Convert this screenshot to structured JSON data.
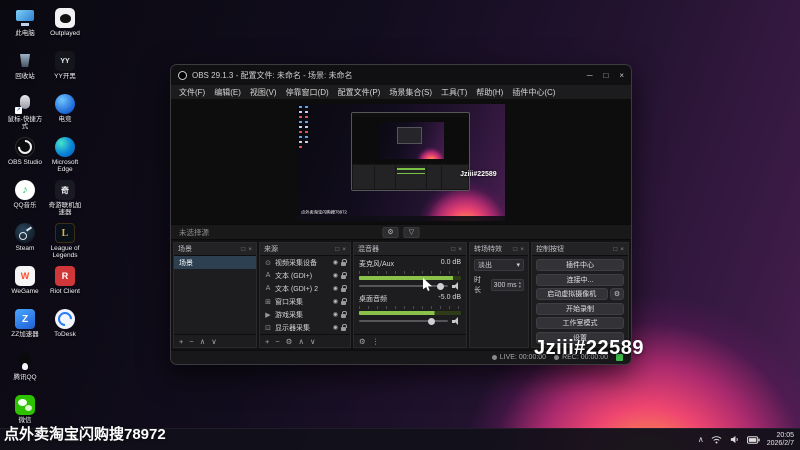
{
  "desktop": {
    "overlay_text": "点外卖淘宝闪购搜78972",
    "watermark": "Jziii#22589",
    "icons_col1": [
      {
        "label": "此电脑"
      },
      {
        "label": "回收站"
      },
      {
        "label": "鼠标-快捷方式"
      },
      {
        "label": "OBS Studio"
      },
      {
        "label": "QQ音乐"
      },
      {
        "label": "Steam"
      },
      {
        "label": "WeGame"
      },
      {
        "label": "ZZ加速器"
      },
      {
        "label": "腾讯QQ"
      },
      {
        "label": "微信"
      }
    ],
    "icons_col2": [
      {
        "label": "Outplayed"
      },
      {
        "label": "YY开黑"
      },
      {
        "label": "电竞"
      },
      {
        "label": "Microsoft Edge"
      },
      {
        "label": "奇游联机加速器"
      },
      {
        "label": "League of Legends"
      },
      {
        "label": "Riot Client"
      },
      {
        "label": "ToDesk"
      }
    ]
  },
  "obs": {
    "title": "OBS 29.1.3 - 配置文件: 未命名 - 场景: 未命名",
    "menu": [
      "文件(F)",
      "编辑(E)",
      "视图(V)",
      "停靠窗口(D)",
      "配置文件(P)",
      "场景集合(S)",
      "工具(T)",
      "帮助(H)",
      "插件中心(C)"
    ],
    "source_toolbar": {
      "no_source": "未选择源"
    },
    "panels": {
      "scenes": {
        "title": "场景",
        "items": [
          "场景"
        ]
      },
      "sources": {
        "title": "来源",
        "items": [
          {
            "icon": "camera-icon",
            "name": "视频采集设备"
          },
          {
            "icon": "text-icon",
            "name": "文本 (GDI+)"
          },
          {
            "icon": "text-icon",
            "name": "文本 (GDI+) 2"
          },
          {
            "icon": "window-icon",
            "name": "窗口采集"
          },
          {
            "icon": "game-icon",
            "name": "游戏采集"
          },
          {
            "icon": "display-icon",
            "name": "显示器采集"
          }
        ]
      },
      "mixer": {
        "title": "混音器",
        "channels": [
          {
            "name": "麦克风/Aux",
            "level": "0.0 dB",
            "meter_percent": 92
          },
          {
            "name": "桌面音频",
            "level": "-5.0 dB",
            "meter_percent": 74
          }
        ]
      },
      "transitions": {
        "title": "转场特效",
        "selected": "淡出",
        "duration_label": "时长",
        "duration_value": "300 ms"
      },
      "controls": {
        "title": "控制按钮",
        "buttons": [
          "插件中心",
          "连接中...",
          "启动虚拟摄像机",
          "开始录制",
          "工作室模式",
          "设置"
        ]
      }
    },
    "statusbar": {
      "live": "LIVE: 00:00:00",
      "rec": "REC: 00:00:00"
    }
  },
  "taskbar": {
    "time": "20:05",
    "date": "2026/2/7"
  },
  "colors": {
    "meter_green": "#8bc34a",
    "selection": "#2c4052",
    "watermark": "#ffffff",
    "wallpaper_glow": "#ee4570"
  }
}
